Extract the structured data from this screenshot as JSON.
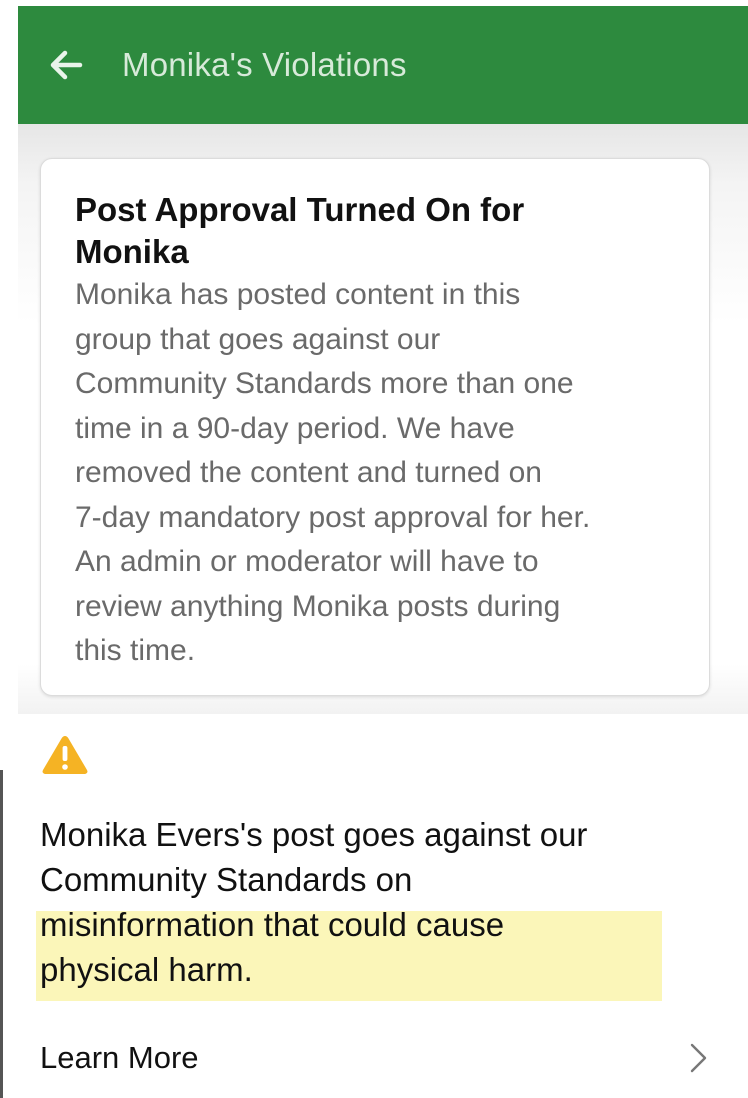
{
  "app_bar": {
    "title": "Monika's Violations",
    "back_icon": "arrow-left-icon",
    "background_color": "#2d8a3e"
  },
  "notice_card": {
    "title_line_1": "Post Approval Turned On for",
    "title_line_2": "Monika",
    "body_lines": [
      "Monika has posted content in this",
      "group that goes against our",
      "Community Standards more than one",
      "time in a 90-day period. We have",
      "removed the content and turned on",
      "7-day mandatory post approval for her.",
      "An admin or moderator will have to",
      "review anything Monika posts during",
      "this time."
    ]
  },
  "violation": {
    "icon": "warning-triangle-icon",
    "icon_color": "#f5b324",
    "line_1": "Monika Evers's post goes against our",
    "line_2": "Community Standards on",
    "highlight_line_1": "misinformation that could cause",
    "highlight_line_2": "physical harm.",
    "highlight_color": "#fbf6b9"
  },
  "learn_more": {
    "label": "Learn More",
    "icon": "chevron-right-icon"
  }
}
